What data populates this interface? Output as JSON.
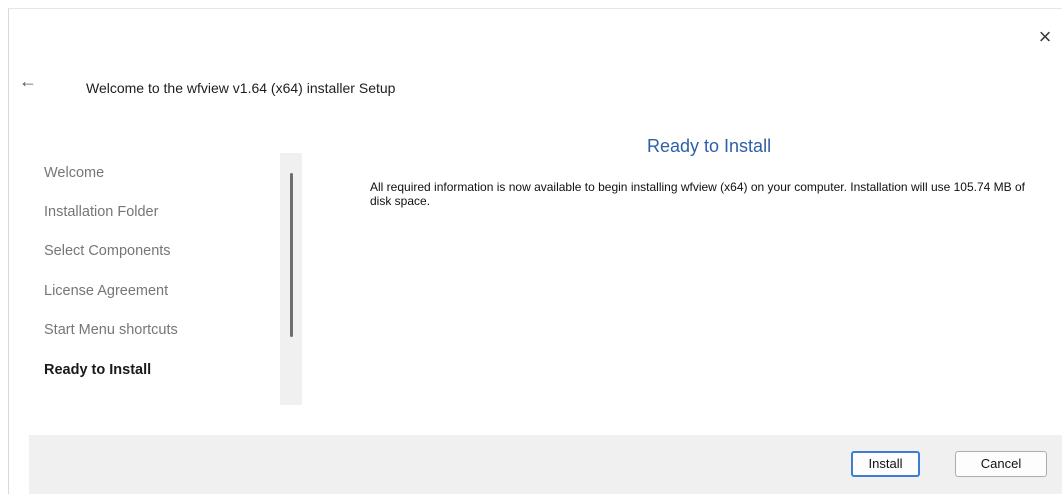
{
  "window": {
    "title": "Welcome to the wfview v1.64 (x64) installer Setup",
    "close_icon": "×",
    "back_icon": "←"
  },
  "sidebar": {
    "steps": [
      {
        "label": "Welcome",
        "active": false
      },
      {
        "label": "Installation Folder",
        "active": false
      },
      {
        "label": "Select Components",
        "active": false
      },
      {
        "label": "License Agreement",
        "active": false
      },
      {
        "label": "Start Menu shortcuts",
        "active": false
      },
      {
        "label": "Ready to Install",
        "active": true
      }
    ]
  },
  "main": {
    "heading": "Ready to Install",
    "message": "All required information is now available to begin installing wfview (x64) on your computer. Installation will use 105.74 MB of disk space."
  },
  "footer": {
    "install_label": "Install",
    "cancel_label": "Cancel"
  },
  "colors": {
    "accent": "#3c7fd1",
    "heading": "#2f5ea8",
    "footer_bg": "#f0f0f0"
  }
}
